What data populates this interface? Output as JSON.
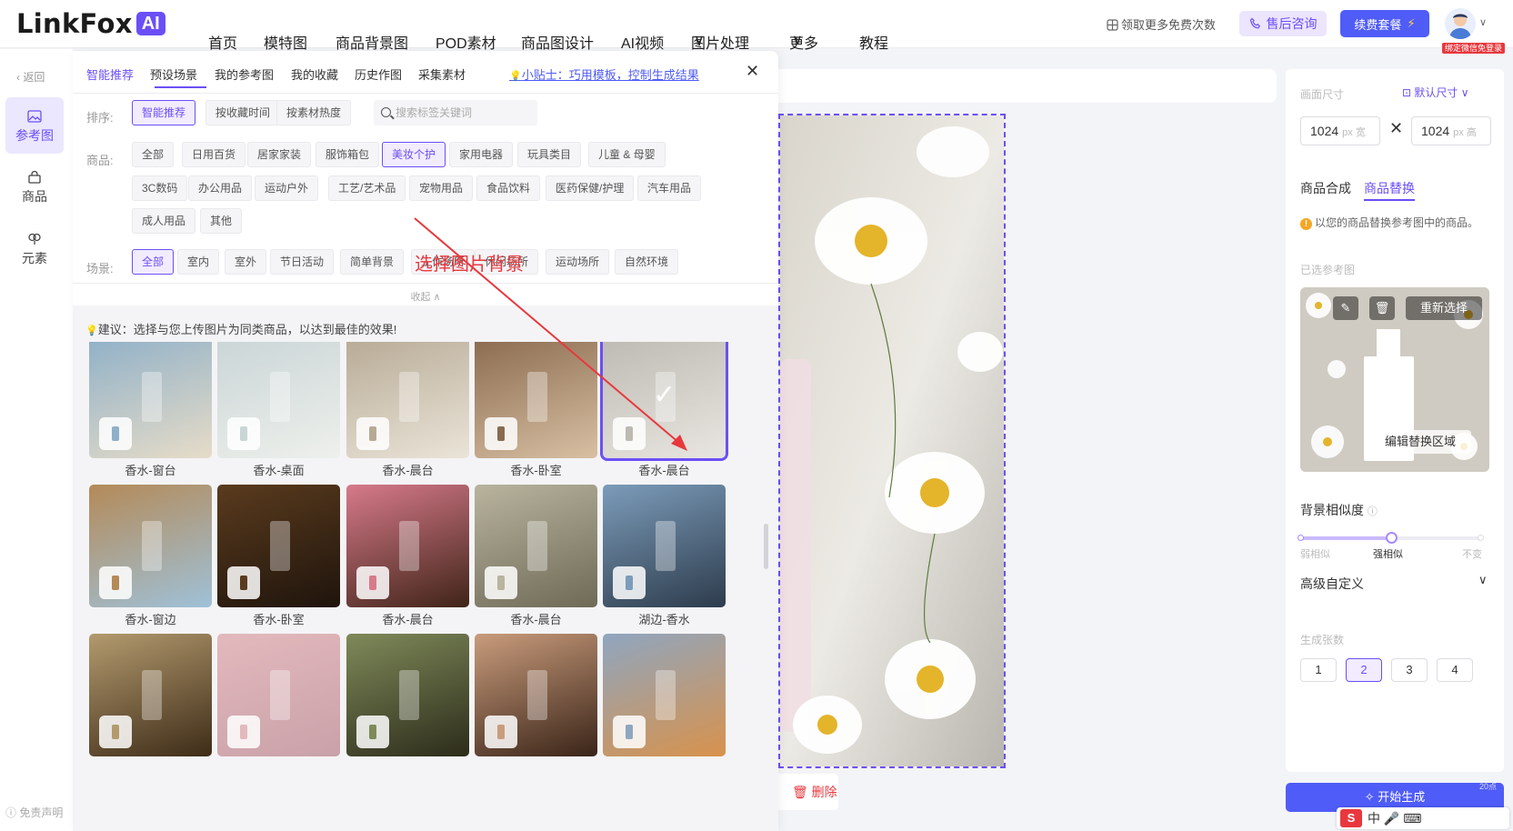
{
  "brand": {
    "name": "LinkFox",
    "badge": "AI",
    "accent": "#6b4ff6"
  },
  "nav": [
    {
      "label": "首页"
    },
    {
      "label": "模特图"
    },
    {
      "label": "商品背景图",
      "active": true
    },
    {
      "label": "POD素材"
    },
    {
      "label": "商品图设计"
    },
    {
      "label": "AI视频"
    },
    {
      "label": "图片处理",
      "dropdown": true
    },
    {
      "label": "更多",
      "dropdown": true
    },
    {
      "label": "教程"
    }
  ],
  "header": {
    "free_text": "领取更多免费次数",
    "consult": "售后咨询",
    "renew": "续费套餐",
    "bind_tag": "绑定微信免登录"
  },
  "sidebar": {
    "back": "返回",
    "items": [
      {
        "label": "参考图",
        "icon": "image-icon",
        "active": true
      },
      {
        "label": "商品",
        "icon": "bag-icon"
      },
      {
        "label": "元素",
        "icon": "element-icon"
      }
    ],
    "disclaimer": "免责声明"
  },
  "panel": {
    "tabs": [
      {
        "label": "智能推荐",
        "active": true
      },
      {
        "label": "预设场景"
      },
      {
        "label": "我的参考图"
      },
      {
        "label": "我的收藏"
      },
      {
        "label": "历史作图"
      },
      {
        "label": "采集素材"
      }
    ],
    "tip": "小贴士：巧用模板，控制生成结果",
    "sort_label": "排序:",
    "sort_options": [
      {
        "label": "智能推荐",
        "active": true
      },
      {
        "label": "按收藏时间"
      },
      {
        "label": "按素材热度"
      }
    ],
    "search_placeholder": "搜索标签关键词",
    "goods_label": "商品:",
    "goods": [
      {
        "label": "全部"
      },
      {
        "label": "日用百货"
      },
      {
        "label": "居家家装"
      },
      {
        "label": "服饰箱包"
      },
      {
        "label": "美妆个护",
        "active": true
      },
      {
        "label": "家用电器"
      },
      {
        "label": "玩具类目"
      },
      {
        "label": "儿童 & 母婴"
      },
      {
        "label": "3C数码"
      },
      {
        "label": "办公用品"
      },
      {
        "label": "运动户外"
      },
      {
        "label": "工艺/艺术品"
      },
      {
        "label": "宠物用品"
      },
      {
        "label": "食品饮料"
      },
      {
        "label": "医药保健/护理"
      },
      {
        "label": "汽车用品"
      },
      {
        "label": "成人用品"
      },
      {
        "label": "其他"
      }
    ],
    "scene_label": "场景:",
    "scenes": [
      {
        "label": "全部",
        "active": true
      },
      {
        "label": "室内"
      },
      {
        "label": "室外"
      },
      {
        "label": "节日活动"
      },
      {
        "label": "简单背景"
      },
      {
        "label": "工作场所"
      },
      {
        "label": "休闲场所"
      },
      {
        "label": "运动场所"
      },
      {
        "label": "自然环境"
      }
    ],
    "collapse": "收起",
    "hint": "建议：选择与您上传图片为同类商品，以达到最佳的效果!",
    "annotation": "选择图片背景"
  },
  "gallery": [
    {
      "caption": "香水-晨台",
      "colors": [
        "#6a4a2e",
        "#2b1f17"
      ]
    },
    {
      "caption": "香水-晨台",
      "colors": [
        "#3a2a1e",
        "#1d1612"
      ]
    },
    {
      "caption": "香水-卧室",
      "colors": [
        "#5b5148",
        "#2e2a26"
      ]
    },
    {
      "caption": "香水-晨台",
      "colors": [
        "#7a5c3b",
        "#3c2b1c"
      ]
    },
    {
      "caption": "香水-花园",
      "colors": [
        "#6b6a52",
        "#33332a"
      ]
    },
    {
      "caption": "香水-窗台",
      "colors": [
        "#8fb0c8",
        "#e6dcc8"
      ]
    },
    {
      "caption": "香水-桌面",
      "colors": [
        "#c9d5d6",
        "#eef0ec"
      ]
    },
    {
      "caption": "香水-晨台",
      "colors": [
        "#b7aa95",
        "#eae4d8"
      ]
    },
    {
      "caption": "香水-卧室",
      "colors": [
        "#8a6a4f",
        "#d8c0a3"
      ]
    },
    {
      "caption": "香水-晨台",
      "colors": [
        "#bdbab2",
        "#e8e6e0"
      ],
      "selected": true
    },
    {
      "caption": "香水-窗边",
      "colors": [
        "#b48a58",
        "#9fc1d8"
      ]
    },
    {
      "caption": "香水-卧室",
      "colors": [
        "#5a3b1e",
        "#1f140c"
      ]
    },
    {
      "caption": "香水-晨台",
      "colors": [
        "#d77a8a",
        "#402418"
      ]
    },
    {
      "caption": "香水-晨台",
      "colors": [
        "#b8b49e",
        "#6e6a56"
      ]
    },
    {
      "caption": "湖边-香水",
      "colors": [
        "#7c9cba",
        "#2d3c4c"
      ]
    },
    {
      "caption": "",
      "colors": [
        "#b39a6e",
        "#3e2c18"
      ]
    },
    {
      "caption": "",
      "colors": [
        "#e3b9bd",
        "#c9a1a8"
      ]
    },
    {
      "caption": "",
      "colors": [
        "#7f8a5a",
        "#2c2c1a"
      ]
    },
    {
      "caption": "",
      "colors": [
        "#c99c7c",
        "#3a2418"
      ]
    },
    {
      "caption": "",
      "colors": [
        "#8fa6c0",
        "#d8924c"
      ]
    }
  ],
  "right_panel": {
    "size_label": "画面尺寸",
    "default_size": "默认尺寸",
    "width": "1024",
    "width_unit": "px 宽",
    "height": "1024",
    "height_unit": "px 高",
    "tabs": [
      {
        "label": "商品合成"
      },
      {
        "label": "商品替换",
        "active": true
      }
    ],
    "note": "以您的商品替换参考图中的商品。",
    "selected_ref_label": "已选参考图",
    "reselect": "重新选择",
    "edit_area": "编辑替换区域",
    "similarity_label": "背景相似度",
    "similarity_levels": [
      "弱相似",
      "强相似",
      "不变"
    ],
    "similarity_value": 0.5,
    "advanced": "高级自定义",
    "count_label": "生成张数",
    "counts": [
      {
        "label": "1"
      },
      {
        "label": "2",
        "active": true
      },
      {
        "label": "3"
      },
      {
        "label": "4"
      }
    ],
    "generate": "开始生成",
    "cost": "20点"
  },
  "canvas": {
    "delete": "删除"
  },
  "ime": {
    "logo": "S",
    "label": "中"
  }
}
